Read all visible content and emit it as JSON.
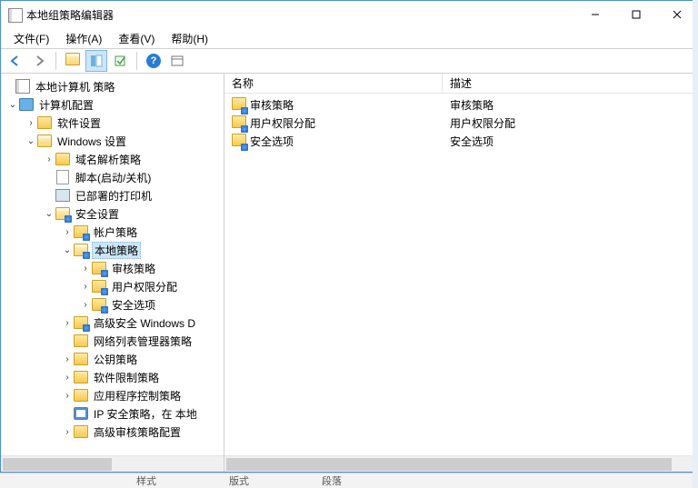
{
  "window": {
    "title": "本地组策略编辑器"
  },
  "menu": {
    "file": "文件(F)",
    "action": "操作(A)",
    "view": "查看(V)",
    "help": "帮助(H)"
  },
  "toolbar": {
    "back": "back",
    "forward": "forward",
    "up": "up",
    "show_hide": "show-hide-tree",
    "export": "export-list",
    "help": "help",
    "props": "properties"
  },
  "tree": {
    "root": "本地计算机 策略",
    "computer_cfg": "计算机配置",
    "software": "软件设置",
    "windows_settings": "Windows 设置",
    "name_resolution": "域名解析策略",
    "scripts": "脚本(启动/关机)",
    "printers": "已部署的打印机",
    "security": "安全设置",
    "account_policies": "帐户策略",
    "local_policies": "本地策略",
    "audit_policy": "审核策略",
    "user_rights": "用户权限分配",
    "security_options": "安全选项",
    "adv_firewall": "高级安全 Windows D",
    "nlm": "网络列表管理器策略",
    "public_key": "公钥策略",
    "srp": "软件限制策略",
    "app_control": "应用程序控制策略",
    "ip_sec": "IP 安全策略，在 本地",
    "adv_audit": "高级审核策略配置"
  },
  "list": {
    "col_name": "名称",
    "col_desc": "描述",
    "rows": [
      {
        "name": "审核策略",
        "desc": "审核策略"
      },
      {
        "name": "用户权限分配",
        "desc": "用户权限分配"
      },
      {
        "name": "安全选项",
        "desc": "安全选项"
      }
    ]
  },
  "bg": {
    "a": "样式",
    "b": "版式",
    "c": "段落"
  }
}
